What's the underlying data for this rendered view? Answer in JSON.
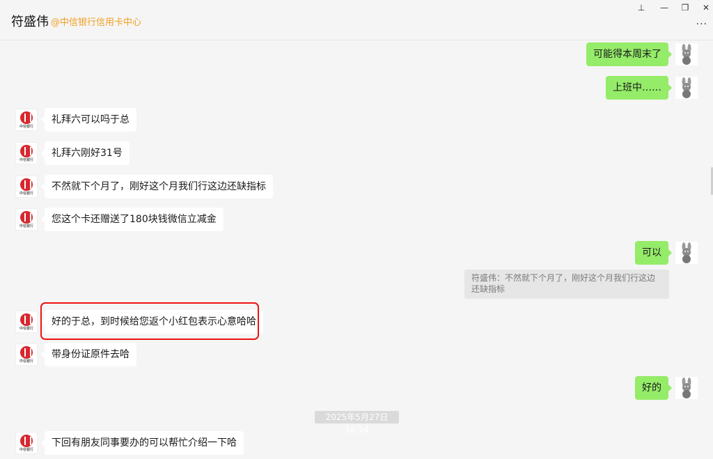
{
  "header": {
    "title": "符盛伟",
    "subtitle": "@中信银行信用卡中心",
    "pin_glyph": "⊥",
    "minimize_glyph": "—",
    "restore_glyph": "❐",
    "close_glyph": "✕",
    "more_glyph": "···"
  },
  "avatars": {
    "bank_logo_text": "中信银行"
  },
  "messages": [
    {
      "side": "right",
      "text": "可能得本周末了"
    },
    {
      "side": "right",
      "text": "上班中……"
    },
    {
      "side": "left",
      "text": "礼拜六可以吗于总"
    },
    {
      "side": "left",
      "text": "礼拜六刚好31号"
    },
    {
      "side": "left",
      "text": "不然就下个月了，刚好这个月我们行这边还缺指标"
    },
    {
      "side": "left",
      "text": "您这个卡还赠送了180块钱微信立减金"
    },
    {
      "side": "right",
      "text": "可以"
    },
    {
      "side": "left",
      "text": "好的于总，到时候给您返个小红包表示心意哈哈"
    },
    {
      "side": "left",
      "text": "带身份证原件去哈"
    },
    {
      "side": "right",
      "text": "好的"
    },
    {
      "side": "left",
      "text": "下回有朋友同事要办的可以帮忙介绍一下哈"
    }
  ],
  "quote": {
    "text": "符盛伟：不然就下个月了，刚好这个月我们行这边还缺指标"
  },
  "timestamp": "2025年5月27日 16:14",
  "colors": {
    "green_bubble": "#95ec69",
    "highlight_border": "#e11111",
    "subtitle_orange": "#f0a020"
  }
}
